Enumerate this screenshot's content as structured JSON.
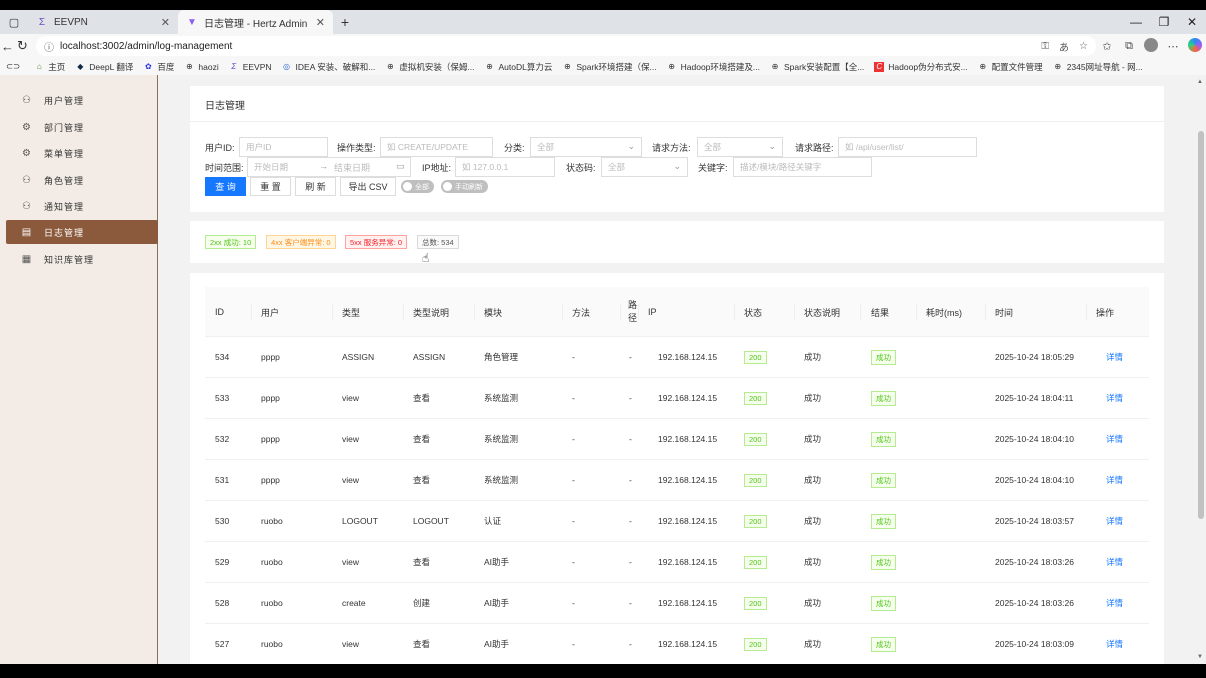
{
  "browser": {
    "tabs": [
      {
        "title": "EEVPN",
        "active": false,
        "icon": "sigma-icon"
      },
      {
        "title": "日志管理 - Hertz Admin",
        "active": true,
        "icon": "vite-icon"
      }
    ],
    "url": "localhost:3002/admin/log-management",
    "bookmarks": [
      "主页",
      "DeepL 翻译",
      "百度",
      "haozi",
      "EEVPN",
      "IDEA 安装、破解和...",
      "虚拟机安装（保姆...",
      "AutoDL算力云",
      "Spark环境搭建（保...",
      "Hadoop环境搭建及...",
      "Spark安装配置【全...",
      "Hadoop伪分布式安...",
      "配置文件管理",
      "2345网址导航 - 网..."
    ]
  },
  "sidebar": {
    "items": [
      {
        "label": "用户管理",
        "icon": "user-icon",
        "active": false
      },
      {
        "label": "部门管理",
        "icon": "gear-icon",
        "active": false
      },
      {
        "label": "菜单管理",
        "icon": "gear-icon",
        "active": false
      },
      {
        "label": "角色管理",
        "icon": "user-icon",
        "active": false
      },
      {
        "label": "通知管理",
        "icon": "user-icon",
        "active": false
      },
      {
        "label": "日志管理",
        "icon": "log-icon",
        "active": true
      },
      {
        "label": "知识库管理",
        "icon": "book-icon",
        "active": false
      }
    ]
  },
  "page": {
    "title": "日志管理"
  },
  "filters": {
    "user_id": {
      "label": "用户ID:",
      "placeholder": "用户ID"
    },
    "op_type": {
      "label": "操作类型:",
      "placeholder": "如 CREATE/UPDATE"
    },
    "category": {
      "label": "分类:",
      "value": "全部"
    },
    "req_method": {
      "label": "请求方法:",
      "value": "全部"
    },
    "req_path": {
      "label": "请求路径:",
      "placeholder": "如 /api/user/list/"
    },
    "time_range": {
      "label": "时间范围:",
      "start": "开始日期",
      "end": "结束日期"
    },
    "ip": {
      "label": "IP地址:",
      "placeholder": "如 127.0.0.1"
    },
    "status_code": {
      "label": "状态码:",
      "value": "全部"
    },
    "keyword": {
      "label": "关键字:",
      "placeholder": "描述/模块/路径关键字"
    }
  },
  "buttons": {
    "query": "查 询",
    "reset": "重 置",
    "refresh": "刷 新",
    "export": "导出 CSV",
    "toggle_all": "全部",
    "toggle_manual": "手动刷新"
  },
  "stats": {
    "ok": "2xx 成功: 10",
    "client_err": "4xx 客户端异常: 0",
    "server_err": "5xx 服务异常: 0",
    "total": "总数: 534"
  },
  "table": {
    "headers": [
      "ID",
      "用户",
      "类型",
      "类型说明",
      "模块",
      "方法",
      "路径",
      "IP",
      "状态",
      "状态说明",
      "结果",
      "耗时(ms)",
      "时间",
      "操作"
    ],
    "rows": [
      {
        "id": "534",
        "user": "pppp",
        "type": "ASSIGN",
        "type_desc": "ASSIGN",
        "module": "角色管理",
        "method": "-",
        "path": "-",
        "ip": "192.168.124.15",
        "status": "200",
        "status_desc": "成功",
        "result": "成功",
        "time": "2025-10-24 18:05:29",
        "action": "详情"
      },
      {
        "id": "533",
        "user": "pppp",
        "type": "view",
        "type_desc": "查看",
        "module": "系统监测",
        "method": "-",
        "path": "-",
        "ip": "192.168.124.15",
        "status": "200",
        "status_desc": "成功",
        "result": "成功",
        "time": "2025-10-24 18:04:11",
        "action": "详情"
      },
      {
        "id": "532",
        "user": "pppp",
        "type": "view",
        "type_desc": "查看",
        "module": "系统监测",
        "method": "-",
        "path": "-",
        "ip": "192.168.124.15",
        "status": "200",
        "status_desc": "成功",
        "result": "成功",
        "time": "2025-10-24 18:04:10",
        "action": "详情"
      },
      {
        "id": "531",
        "user": "pppp",
        "type": "view",
        "type_desc": "查看",
        "module": "系统监测",
        "method": "-",
        "path": "-",
        "ip": "192.168.124.15",
        "status": "200",
        "status_desc": "成功",
        "result": "成功",
        "time": "2025-10-24 18:04:10",
        "action": "详情"
      },
      {
        "id": "530",
        "user": "ruobo",
        "type": "LOGOUT",
        "type_desc": "LOGOUT",
        "module": "认证",
        "method": "-",
        "path": "-",
        "ip": "192.168.124.15",
        "status": "200",
        "status_desc": "成功",
        "result": "成功",
        "time": "2025-10-24 18:03:57",
        "action": "详情"
      },
      {
        "id": "529",
        "user": "ruobo",
        "type": "view",
        "type_desc": "查看",
        "module": "AI助手",
        "method": "-",
        "path": "-",
        "ip": "192.168.124.15",
        "status": "200",
        "status_desc": "成功",
        "result": "成功",
        "time": "2025-10-24 18:03:26",
        "action": "详情"
      },
      {
        "id": "528",
        "user": "ruobo",
        "type": "create",
        "type_desc": "创建",
        "module": "AI助手",
        "method": "-",
        "path": "-",
        "ip": "192.168.124.15",
        "status": "200",
        "status_desc": "成功",
        "result": "成功",
        "time": "2025-10-24 18:03:26",
        "action": "详情"
      },
      {
        "id": "527",
        "user": "ruobo",
        "type": "view",
        "type_desc": "查看",
        "module": "AI助手",
        "method": "-",
        "path": "-",
        "ip": "192.168.124.15",
        "status": "200",
        "status_desc": "成功",
        "result": "成功",
        "time": "2025-10-24 18:03:09",
        "action": "详情"
      }
    ]
  }
}
